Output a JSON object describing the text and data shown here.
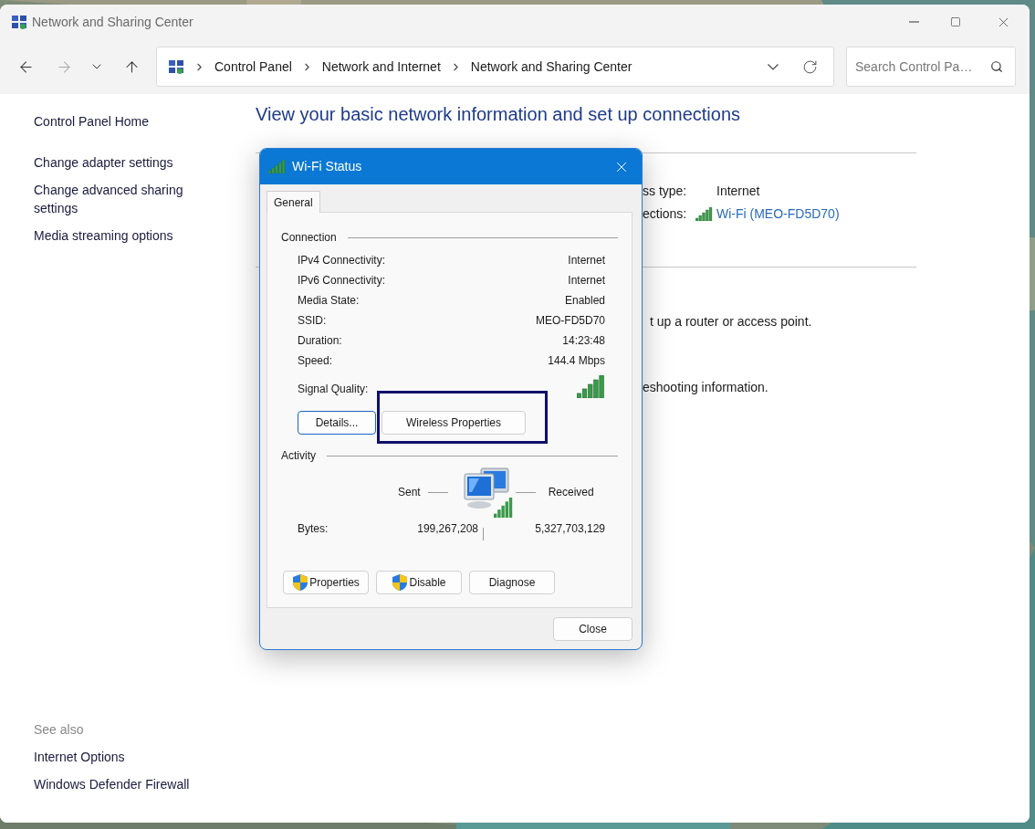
{
  "window": {
    "title": "Network and Sharing Center"
  },
  "navigation": {
    "forward_disabled": true
  },
  "breadcrumb": [
    "Control Panel",
    "Network and Internet",
    "Network and Sharing Center"
  ],
  "search": {
    "placeholder": "Search Control Pa…"
  },
  "sidebar": {
    "links": [
      "Control Panel Home",
      "Change adapter settings",
      "Change advanced sharing settings",
      "Media streaming options"
    ],
    "see_also_title": "See also",
    "see_also_links": [
      "Internet Options",
      "Windows Defender Firewall"
    ]
  },
  "main": {
    "heading": "View your basic network information and set up connections",
    "access_type_fragment": "ss type:",
    "access_type_value": "Internet",
    "connections_fragment": "ections:",
    "connection_link": "Wi-Fi (MEO-FD5D70)",
    "router_fragment": "t up a router or access point.",
    "troubleshoot_fragment": "eshooting information."
  },
  "dialog": {
    "title": "Wi-Fi Status",
    "tabs": [
      {
        "label": "General",
        "selected": true
      }
    ],
    "connection_title": "Connection",
    "rows": [
      {
        "label": "IPv4 Connectivity:",
        "value": "Internet"
      },
      {
        "label": "IPv6 Connectivity:",
        "value": "Internet"
      },
      {
        "label": "Media State:",
        "value": "Enabled"
      },
      {
        "label": "SSID:",
        "value": "MEO-FD5D70"
      },
      {
        "label": "Duration:",
        "value": "14:23:48"
      },
      {
        "label": "Speed:",
        "value": "144.4 Mbps"
      }
    ],
    "signal_label": "Signal Quality:",
    "top_buttons": [
      {
        "label": "Details...",
        "focused": true
      },
      {
        "label": "Wireless Properties",
        "focused": false
      }
    ],
    "activity": {
      "title": "Activity",
      "sent": "Sent",
      "received": "Received",
      "bytes_label": "Bytes:",
      "bytes_sent": "199,267,208",
      "bytes_received": "5,327,703,129"
    },
    "actions": [
      {
        "label": "Properties",
        "shield": true
      },
      {
        "label": "Disable",
        "shield": true
      },
      {
        "label": "Diagnose",
        "shield": false
      }
    ],
    "close": "Close"
  }
}
